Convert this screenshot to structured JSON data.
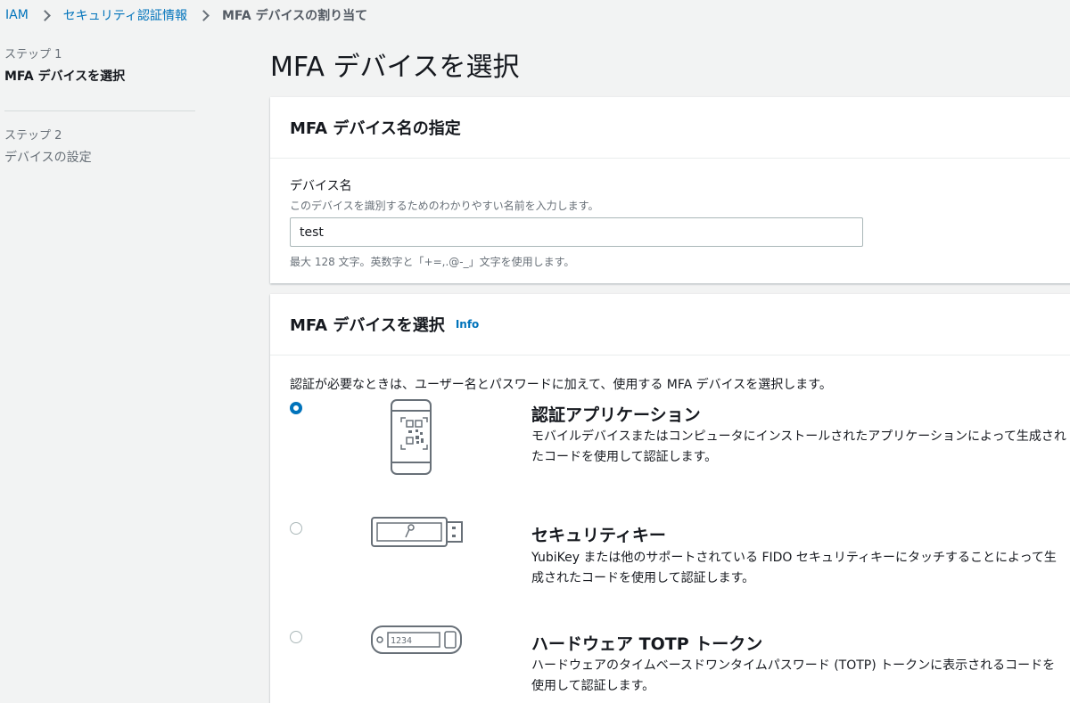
{
  "breadcrumb": {
    "items": [
      "IAM",
      "セキュリティ認証情報"
    ],
    "current": "MFA デバイスの割り当て"
  },
  "steps": [
    {
      "label": "ステップ 1",
      "title": "MFA デバイスを選択"
    },
    {
      "label": "ステップ 2",
      "title": "デバイスの設定"
    }
  ],
  "page_title": "MFA デバイスを選択",
  "device_name_panel": {
    "header": "MFA デバイス名の指定",
    "field_label": "デバイス名",
    "field_description": "このデバイスを識別するためのわかりやすい名前を入力します。",
    "field_value": "test",
    "field_constraint": "最大 128 文字。英数字と「+=,.@-_」文字を使用します。"
  },
  "device_select_panel": {
    "header": "MFA デバイスを選択",
    "info_link": "Info",
    "intro": "認証が必要なときは、ユーザー名とパスワードに加えて、使用する MFA デバイスを選択します。",
    "options": [
      {
        "title": "認証アプリケーション",
        "description": "モバイルデバイスまたはコンピュータにインストールされたアプリケーションによって生成されたコードを使用して認証します。",
        "selected": true,
        "icon": "phone-qr-icon"
      },
      {
        "title": "セキュリティキー",
        "description": "YubiKey または他のサポートされている FIDO セキュリティキーにタッチすることによって生成されたコードを使用して認証します。",
        "selected": false,
        "icon": "usb-key-icon"
      },
      {
        "title": "ハードウェア TOTP トークン",
        "description": "ハードウェアのタイムベースドワンタイムパスワード (TOTP) トークンに表示されるコードを使用して認証します。",
        "selected": false,
        "icon": "totp-token-icon",
        "token_display": "1234"
      }
    ]
  },
  "colors": {
    "link": "#0073bb",
    "background": "#f2f3f3",
    "text": "#16191f",
    "secondary_text": "#687078"
  }
}
